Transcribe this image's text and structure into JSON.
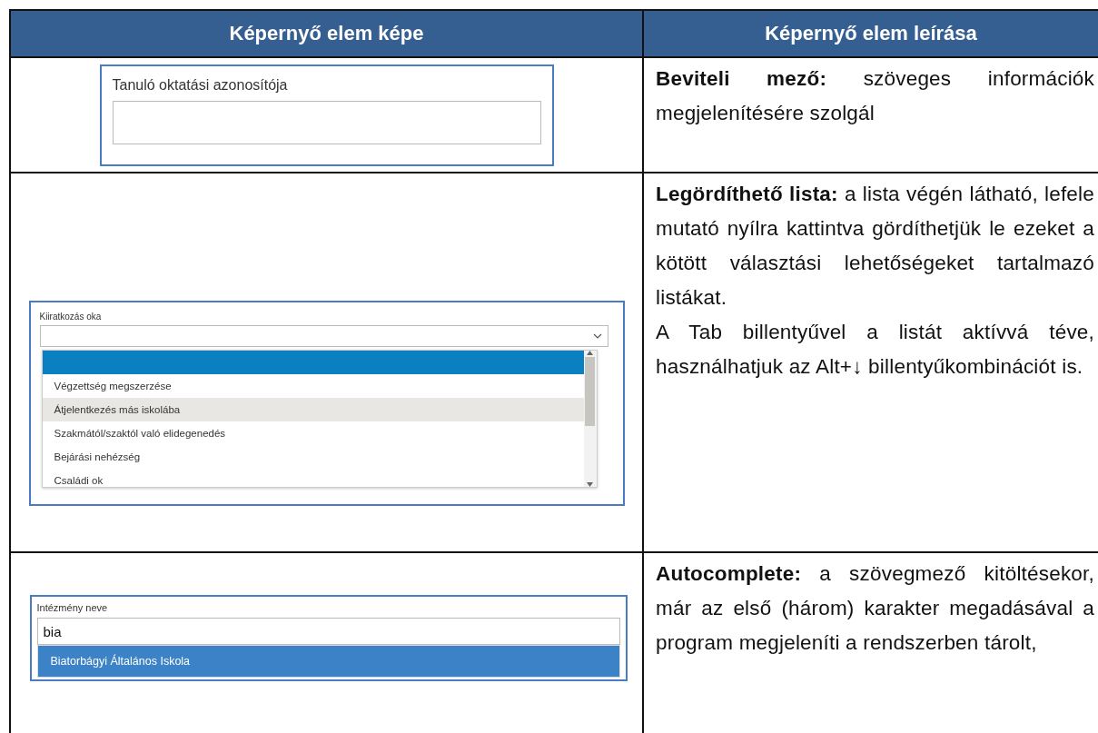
{
  "table": {
    "columns": [
      "Képernyő elem képe",
      "Képernyő elem leírása"
    ],
    "rows": [
      {
        "kind": "text-field",
        "preview": {
          "label": "Tanuló oktatási azonosítója"
        },
        "description": [
          "**Beviteli mező:** szöveges információk megjelenítésére szolgál"
        ]
      },
      {
        "kind": "dropdown",
        "preview": {
          "label": "Kiiratkozás oka",
          "options": [
            {
              "selected": true,
              "hovered": false
            },
            {
              "label": "Végzettség megszerzése",
              "selected": false,
              "hovered": false
            },
            {
              "label": "Átjelentkezés más iskolába",
              "selected": false,
              "hovered": true
            },
            {
              "label": "Szakmától/szaktól való elidegenedés",
              "selected": false,
              "hovered": false
            },
            {
              "label": "Bejárási nehézség",
              "selected": false,
              "hovered": false
            },
            {
              "label": "Családi ok",
              "selected": false,
              "hovered": false
            }
          ]
        },
        "description": [
          "**Legördíthető lista:** a lista végén látható, lefele mutató nyílra kattintva gördíthetjük le ezeket a kötött választási lehetőségeket tartalmazó listákat.",
          "A Tab billentyűvel a listát aktívvá téve, használhatjuk az Alt+↓ billentyűkombinációt is."
        ]
      },
      {
        "kind": "autocomplete",
        "preview": {
          "label": "Intézmény neve",
          "value": "bia",
          "suggestions": [
            {
              "label": "Biatorbágyi Általános Iskola",
              "selected": true
            }
          ]
        },
        "description": [
          "**Autocomplete:** a szövegmező kitöltésekor, már az első (három) karakter megadásával a program megjeleníti a rendszerben tárolt,"
        ]
      }
    ]
  }
}
